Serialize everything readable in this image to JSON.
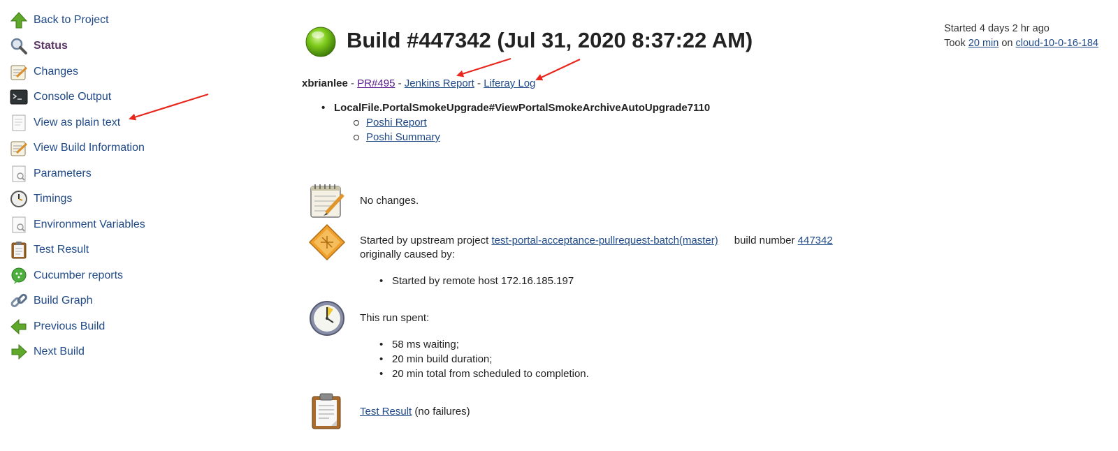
{
  "sidebar": {
    "items": [
      {
        "label": "Back to Project",
        "icon": "up-arrow-icon"
      },
      {
        "label": "Status",
        "icon": "magnifier-icon",
        "current": true
      },
      {
        "label": "Changes",
        "icon": "notepad-icon"
      },
      {
        "label": "Console Output",
        "icon": "terminal-icon"
      },
      {
        "label": "View as plain text",
        "icon": "document-icon"
      },
      {
        "label": "View Build Information",
        "icon": "notepad-icon"
      },
      {
        "label": "Parameters",
        "icon": "document-search-icon"
      },
      {
        "label": "Timings",
        "icon": "clock-icon"
      },
      {
        "label": "Environment Variables",
        "icon": "document-search-icon"
      },
      {
        "label": "Test Result",
        "icon": "clipboard-icon"
      },
      {
        "label": "Cucumber reports",
        "icon": "cucumber-icon"
      },
      {
        "label": "Build Graph",
        "icon": "chain-link-icon"
      },
      {
        "label": "Previous Build",
        "icon": "left-arrow-icon"
      },
      {
        "label": "Next Build",
        "icon": "right-arrow-icon"
      }
    ]
  },
  "build": {
    "title": "Build #447342 (Jul 31, 2020 8:37:22 AM)",
    "status_color": "#6cbf1a",
    "started": "Started 4 days 2 hr ago",
    "took_prefix": "Took ",
    "duration_link": "20 min",
    "on_word": " on ",
    "node_link": "cloud-10-0-16-184"
  },
  "description": {
    "user": "xbrianlee",
    "sep1": " - ",
    "pr_link": "PR#495",
    "sep2": " - ",
    "jenkins_report_link": "Jenkins Report",
    "sep3": " - ",
    "liferay_log_link": "Liferay Log"
  },
  "tests": [
    {
      "name": "LocalFile.PortalSmokeUpgrade#ViewPortalSmokeArchiveAutoUpgrade7110",
      "links": [
        "Poshi Report",
        "Poshi Summary"
      ]
    }
  ],
  "changes": {
    "text": "No changes."
  },
  "cause": {
    "prefix": "Started by upstream project ",
    "project_link": "test-portal-acceptance-pullrequest-batch(master)",
    "build_number_label": "build number ",
    "build_number_link": "447342",
    "caused_by": "originally caused by:",
    "items": [
      "Started by remote host 172.16.185.197"
    ]
  },
  "timing": {
    "heading": "This run spent:",
    "items": [
      "58 ms waiting;",
      "20 min build duration;",
      "20 min total from scheduled to completion."
    ]
  },
  "test_result": {
    "link": "Test Result",
    "suffix": " (no failures)"
  },
  "annotation_color": "#e8261c"
}
